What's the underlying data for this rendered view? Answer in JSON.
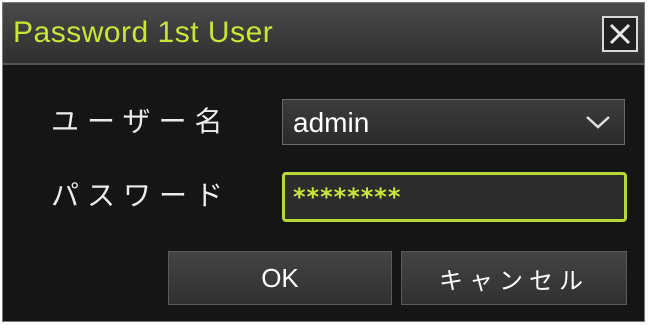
{
  "dialog": {
    "title": "Password 1st User",
    "close_icon": "close-icon"
  },
  "form": {
    "user_label": "ユーザー名",
    "user_value": "admin",
    "password_label": "パスワード",
    "password_value": "********"
  },
  "buttons": {
    "ok_label": "OK",
    "cancel_label": "キャンセル"
  },
  "colors": {
    "accent": "#c8e63a",
    "background": "#151515"
  }
}
